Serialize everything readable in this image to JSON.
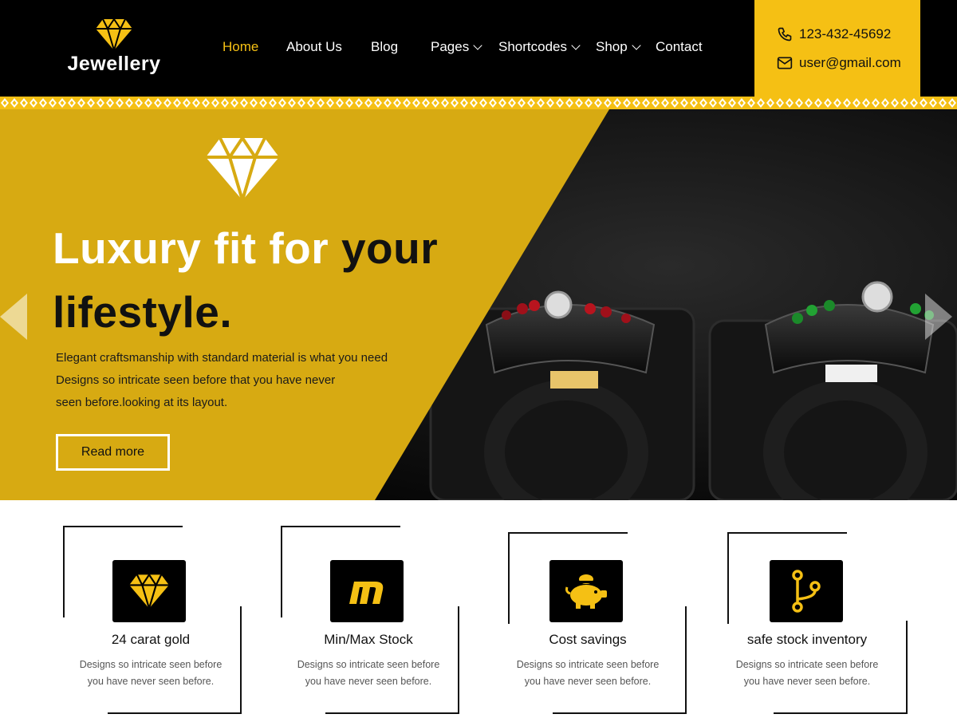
{
  "brand": {
    "name": "Jewellery",
    "logo_icon": "diamond-icon",
    "accent": "#f5c014"
  },
  "nav": [
    {
      "label": "Home",
      "active": true
    },
    {
      "label": "About Us"
    },
    {
      "label": "Blog"
    },
    {
      "label": "Pages",
      "dropdown": true
    },
    {
      "label": "Shortcodes",
      "dropdown": true
    },
    {
      "label": "Shop",
      "dropdown": true
    },
    {
      "label": "Contact"
    }
  ],
  "contact": {
    "phone": "123-432-45692",
    "email": "user@gmail.com"
  },
  "hero": {
    "title_part1": "Luxury fit for ",
    "title_part2": "your",
    "title_part3": "lifestyle.",
    "desc_line1": "Elegant craftsmanship with standard material is what you need",
    "desc_line2": "Designs so intricate seen before that you have never",
    "desc_line3": "seen before.looking at its layout.",
    "button": "Read more",
    "yellow": "#d7aa12"
  },
  "features": [
    {
      "title": "24 carat gold",
      "icon": "diamond-icon",
      "desc_line1": "Designs so intricate seen before",
      "desc_line2": "you have never seen before."
    },
    {
      "title": "Min/Max Stock",
      "icon": "m-letter-icon",
      "desc_line1": "Designs so intricate seen before",
      "desc_line2": "you have never seen before."
    },
    {
      "title": "Cost savings",
      "icon": "piggy-bank-icon",
      "desc_line1": "Designs so intricate seen before",
      "desc_line2": "you have never seen before."
    },
    {
      "title": "safe stock inventory",
      "icon": "branch-icon",
      "desc_line1": "Designs so intricate seen before",
      "desc_line2": "you have never seen before."
    }
  ]
}
